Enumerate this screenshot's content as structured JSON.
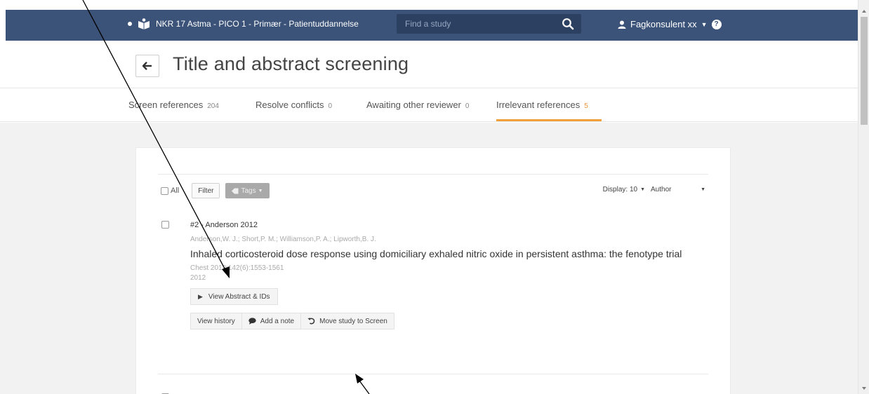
{
  "nav": {
    "project": "NKR 17 Astma - PICO 1 - Primær - Patientuddannelse",
    "search_placeholder": "Find a study",
    "user_name": "Fagkonsulent xx",
    "help": "?"
  },
  "page": {
    "title": "Title and abstract screening"
  },
  "tabs": [
    {
      "label": "Screen references",
      "count": "204"
    },
    {
      "label": "Resolve conflicts",
      "count": "0"
    },
    {
      "label": "Awaiting other reviewer",
      "count": "0"
    },
    {
      "label": "Irrelevant references",
      "count": "5"
    }
  ],
  "toolbar": {
    "all_label": "All",
    "filter_label": "Filter",
    "tags_label": "Tags",
    "display_label": "Display: 10",
    "sort_label": "Author"
  },
  "reference": {
    "id": "#2 - Anderson 2012",
    "authors": "Anderson,W. J.; Short,P. M.; Williamson,P. A.; Lipworth,B. J.",
    "title": "Inhaled corticosteroid dose response using domiciliary exhaled nitric oxide in persistent asthma: the fenotype trial",
    "journal": "Chest 2012;142(6):1553-1561",
    "year": "2012",
    "abstract_label": "View Abstract & IDs",
    "view_history_label": "View history",
    "add_note_label": "Add a note",
    "move_label": "Move study to Screen"
  },
  "colors": {
    "nav_bg": "#3b5378",
    "active_tab_underline": "#f0a13a",
    "page_bg": "#f2f2f2"
  }
}
